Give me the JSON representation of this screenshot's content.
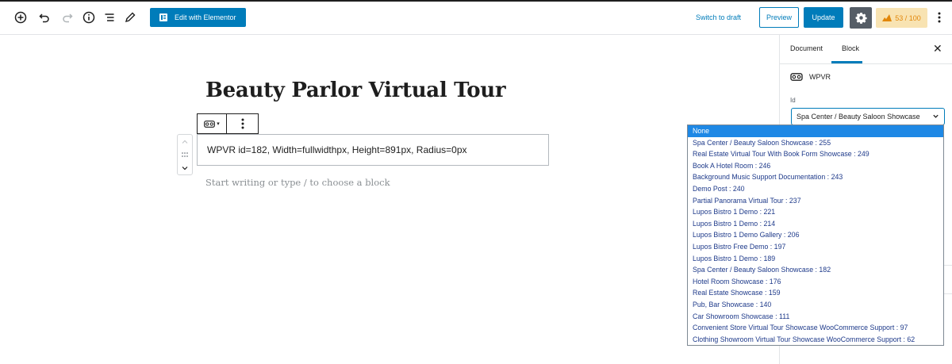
{
  "toolbar": {
    "elementor_label": "Edit with Elementor",
    "switch_draft_label": "Switch to draft",
    "preview_label": "Preview",
    "update_label": "Update",
    "score_label": "53 / 100"
  },
  "editor": {
    "title": "Beauty Parlor Virtual Tour",
    "block_text": "WPVR id=182, Width=fullwidthpx, Height=891px, Radius=0px",
    "placeholder": "Start writing or type / to choose a block"
  },
  "sidebar": {
    "tabs": [
      "Document",
      "Block"
    ],
    "block_name": "WPVR",
    "field_label": "Id",
    "select_value": "Spa Center / Beauty Saloon Showcase"
  },
  "dropdown": {
    "options": [
      "None",
      "Spa Center / Beauty Saloon Showcase : 255",
      "Real Estate Virtual Tour With Book Form Showcase : 249",
      "Book A Hotel Room : 246",
      "Background Music Support Documentation : 243",
      "Demo Post : 240",
      "Partial Panorama Virtual Tour : 237",
      "Lupos Bistro 1 Demo : 221",
      "Lupos Bistro 1 Demo : 214",
      "Lupos Bistro 1 Demo Gallery : 206",
      "Lupos Bistro Free Demo : 197",
      "Lupos Bistro 1 Demo : 189",
      "Spa Center / Beauty Saloon Showcase : 182",
      "Hotel Room Showcase : 176",
      "Real Estate Showcase : 159",
      "Pub, Bar Showcase : 140",
      "Car Showroom Showcase : 111",
      "Convenient Store Virtual Tour Showcase WooCommerce Support : 97",
      "Clothing Showroom Virtual Tour Showcase WooCommerce Support : 62"
    ],
    "selected_index": 0
  },
  "colors": {
    "accent": "#007cba",
    "selected_option": "#1e88e5",
    "score_badge_bg": "#f8e3b2",
    "score_badge_text": "#e2870a"
  }
}
